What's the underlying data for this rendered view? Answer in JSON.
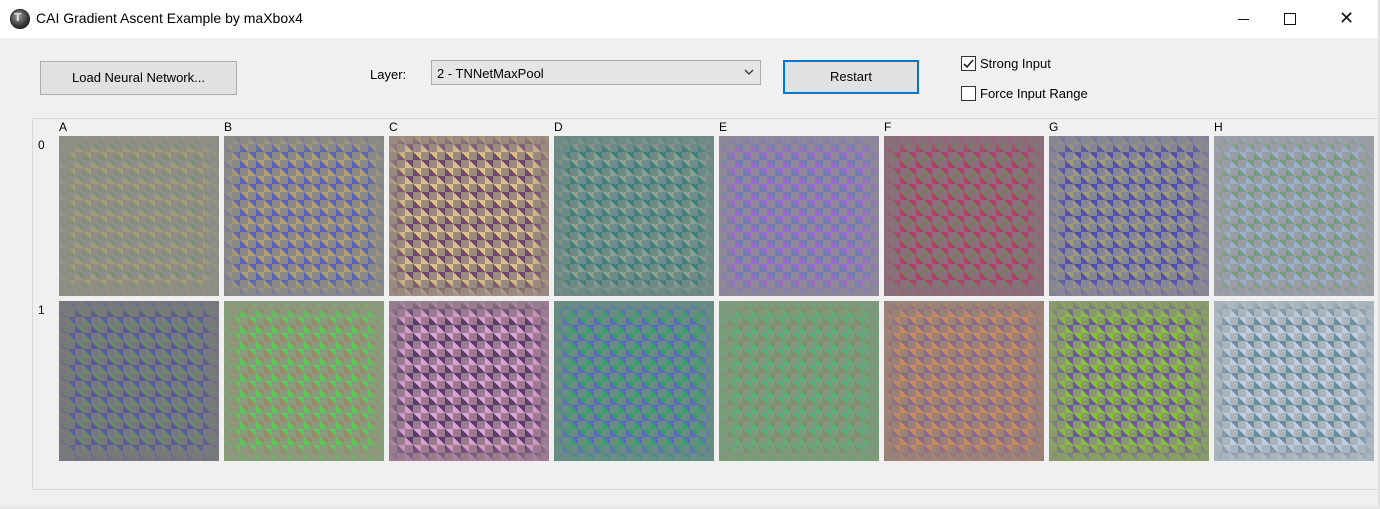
{
  "window": {
    "title": "CAI Gradient Ascent Example by maXbox4",
    "icon": "app-logo-icon",
    "controls": {
      "minimize": "minimize-icon",
      "maximize": "maximize-icon",
      "close": "close-icon"
    }
  },
  "toolbar": {
    "load_label": "Load Neural Network...",
    "layer_label": "Layer:",
    "layer_value": "2 - TNNetMaxPool",
    "restart_label": "Restart"
  },
  "options": {
    "strong_input": {
      "label": "Strong Input",
      "checked": true
    },
    "force_input_range": {
      "label": "Force Input Range",
      "checked": false
    }
  },
  "grid": {
    "columns": [
      "A",
      "B",
      "C",
      "D",
      "E",
      "F",
      "G",
      "H"
    ],
    "rows": [
      "0",
      "1"
    ],
    "cells": [
      [
        {
          "c1": "#a59a78",
          "c2": "#7d8f7a",
          "bg": "#8e8e86"
        },
        {
          "c1": "#5a62b8",
          "c2": "#b0a070",
          "bg": "#8b8a88"
        },
        {
          "c1": "#e0c08a",
          "c2": "#6c4a6a",
          "bg": "#9a8a80"
        },
        {
          "c1": "#3f7f80",
          "c2": "#8aa090",
          "bg": "#708a86"
        },
        {
          "c1": "#9a6ad0",
          "c2": "#6f7fb0",
          "bg": "#8e8898"
        },
        {
          "c1": "#b0406a",
          "c2": "#7a7a60",
          "bg": "#8a6f7c"
        },
        {
          "c1": "#5050b0",
          "c2": "#a09a7a",
          "bg": "#868694"
        },
        {
          "c1": "#9ab0d0",
          "c2": "#7a9a80",
          "bg": "#9a9ea4"
        }
      ],
      [
        {
          "c1": "#5a5a9a",
          "c2": "#6a8a6a",
          "bg": "#78787e"
        },
        {
          "c1": "#5ac85a",
          "c2": "#9a8a6a",
          "bg": "#8a9a7c"
        },
        {
          "c1": "#e0a0d0",
          "c2": "#5a3a6a",
          "bg": "#9a7c90"
        },
        {
          "c1": "#3aa06a",
          "c2": "#5a6ac0",
          "bg": "#6a8c84"
        },
        {
          "c1": "#5ab07a",
          "c2": "#8a8a6a",
          "bg": "#7c9a7c"
        },
        {
          "c1": "#d08a5a",
          "c2": "#8a6a8a",
          "bg": "#9a8278"
        },
        {
          "c1": "#8ac040",
          "c2": "#6a5a9a",
          "bg": "#8a9a6c"
        },
        {
          "c1": "#c0d0e0",
          "c2": "#6a8aa0",
          "bg": "#aab4bc"
        }
      ]
    ]
  }
}
